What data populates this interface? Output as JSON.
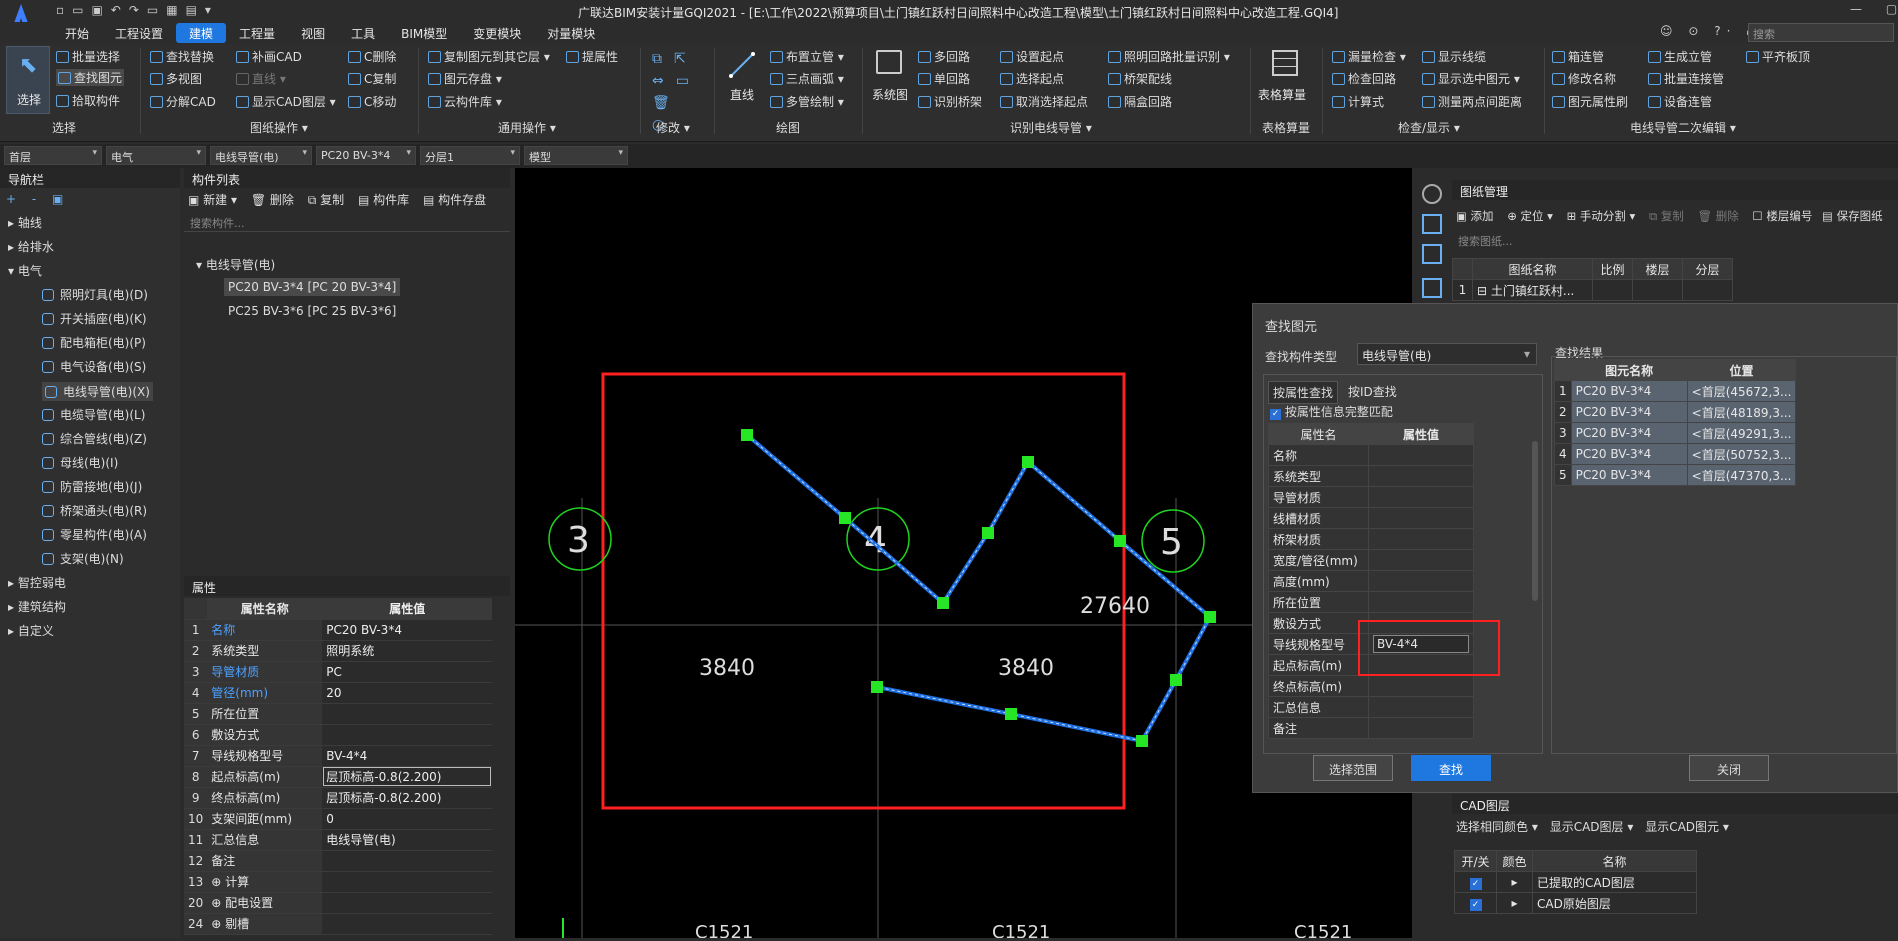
{
  "app": {
    "title": "广联达BIM安装计量GQI2021 - [E:\\工作\\2022\\预算项目\\土门镇红跃村日间照料中心改造工程\\模型\\土门镇红跃村日间照料中心改造工程.GQI4]",
    "search_placeholder": "搜索"
  },
  "menu": [
    "开始",
    "工程设置",
    "建模",
    "工程量",
    "视图",
    "工具",
    "BIM模型",
    "变更模块",
    "对量模块"
  ],
  "menu_active": "建模",
  "ribbon": {
    "select": {
      "big": "选择",
      "items": [
        "批量选择",
        "查找图元",
        "拾取构件"
      ],
      "group": "选择"
    },
    "drawing": {
      "items": [
        "查找替换",
        "补画CAD",
        "C删除",
        "多视图",
        "直线",
        "C复制",
        "分解CAD",
        "显示CAD图层",
        "C移动"
      ],
      "group": "图纸操作"
    },
    "general": {
      "items": [
        "复制图元到其它层",
        "提属性",
        "图元存盘",
        "云构件库"
      ],
      "group": "通用操作"
    },
    "modify": {
      "group": "修改"
    },
    "draw": {
      "big": "直线",
      "items": [
        "布置立管",
        "三点画弧",
        "多管绘制"
      ],
      "group": "绘图"
    },
    "identify": {
      "big": "系统图",
      "items": [
        "多回路",
        "设置起点",
        "照明回路批量识别",
        "单回路",
        "选择起点",
        "桥架配线",
        "识别桥架",
        "取消选择起点",
        "隔盒回路"
      ],
      "group": "识别电线导管"
    },
    "table": {
      "big": "表格算量",
      "group": "表格算量"
    },
    "check": {
      "items": [
        "漏量检查",
        "显示线缆",
        "检查回路",
        "显示选中图元",
        "计算式",
        "测量两点间距离"
      ],
      "group": "检查/显示"
    },
    "edit2": {
      "items": [
        "箱连管",
        "生成立管",
        "平齐板顶",
        "修改名称",
        "批量连接管",
        "图元属性刷",
        "设备连管"
      ],
      "group": "电线导管二次编辑"
    }
  },
  "selectors": [
    "首层",
    "电气",
    "电线导管(电)",
    "PC20 BV-3*4",
    "分层1",
    "模型"
  ],
  "nav": {
    "title": "导航栏",
    "items": [
      "轴线",
      "给排水",
      "电气",
      "智控弱电",
      "建筑结构",
      "自定义"
    ],
    "sub": [
      "照明灯具(电)(D)",
      "开关插座(电)(K)",
      "配电箱柜(电)(P)",
      "电气设备(电)(S)",
      "电线导管(电)(X)",
      "电缆导管(电)(L)",
      "综合管线(电)(Z)",
      "母线(电)(I)",
      "防雷接地(电)(J)",
      "桥架通头(电)(R)",
      "零星构件(电)(A)",
      "支架(电)(N)"
    ]
  },
  "complist": {
    "title": "构件列表",
    "toolbar": [
      "新建",
      "删除",
      "复制",
      "构件库",
      "构件存盘"
    ],
    "search_placeholder": "搜索构件...",
    "root": "电线导管(电)",
    "items": [
      "PC20 BV-3*4 [PC 20 BV-3*4]",
      "PC25 BV-3*6 [PC 25 BV-3*6]"
    ]
  },
  "props": {
    "title": "属性",
    "col_name": "属性名称",
    "col_value": "属性值",
    "rows": [
      {
        "n": "1",
        "k": "名称",
        "v": "PC20 BV-3*4",
        "blue": true
      },
      {
        "n": "2",
        "k": "系统类型",
        "v": "照明系统"
      },
      {
        "n": "3",
        "k": "导管材质",
        "v": "PC",
        "blue": true
      },
      {
        "n": "4",
        "k": "管径(mm)",
        "v": "20",
        "blue": true
      },
      {
        "n": "5",
        "k": "所在位置",
        "v": ""
      },
      {
        "n": "6",
        "k": "敷设方式",
        "v": ""
      },
      {
        "n": "7",
        "k": "导线规格型号",
        "v": "BV-4*4"
      },
      {
        "n": "8",
        "k": "起点标高(m)",
        "v": "层顶标高-0.8(2.200)"
      },
      {
        "n": "9",
        "k": "终点标高(m)",
        "v": "层顶标高-0.8(2.200)"
      },
      {
        "n": "10",
        "k": "支架间距(mm)",
        "v": "0"
      },
      {
        "n": "11",
        "k": "汇总信息",
        "v": "电线导管(电)"
      },
      {
        "n": "12",
        "k": "备注",
        "v": ""
      },
      {
        "n": "13",
        "k": "⊕ 计算",
        "v": ""
      },
      {
        "n": "20",
        "k": "⊕ 配电设置",
        "v": ""
      },
      {
        "n": "24",
        "k": "⊕ 剔槽",
        "v": ""
      }
    ]
  },
  "canvas": {
    "axes": [
      "3",
      "4",
      "5"
    ],
    "dims": [
      "3840",
      "3840",
      "27640"
    ],
    "bottom": [
      "C1521",
      "C1521",
      "C1521"
    ]
  },
  "drawings": {
    "title": "图纸管理",
    "toolbar": [
      "添加",
      "定位",
      "手动分割",
      "复制",
      "删除",
      "楼层编号",
      "保存图纸"
    ],
    "search_placeholder": "搜索图纸...",
    "cols": [
      "图纸名称",
      "比例",
      "楼层",
      "分层"
    ],
    "row": [
      "1",
      "土门镇红跃村...",
      "",
      ""
    ]
  },
  "find": {
    "title": "查找图元",
    "type_label": "查找构件类型",
    "type_value": "电线导管(电)",
    "tabs": [
      "按属性查找",
      "按ID查找"
    ],
    "checkbox": "按属性信息完整匹配",
    "cols": [
      "属性名",
      "属性值"
    ],
    "rows": [
      "名称",
      "系统类型",
      "导管材质",
      "线槽材质",
      "桥架材质",
      "宽度/管径(mm)",
      "高度(mm)",
      "所在位置",
      "敷设方式",
      "导线规格型号",
      "起点标高(m)",
      "终点标高(m)",
      "汇总信息",
      "备注"
    ],
    "input_value": "BV-4*4",
    "results_title": "查找结果",
    "res_cols": [
      "图元名称",
      "位置"
    ],
    "results": [
      [
        "1",
        "PC20 BV-3*4",
        "<首层(45672,3..."
      ],
      [
        "2",
        "PC20 BV-3*4",
        "<首层(48189,3..."
      ],
      [
        "3",
        "PC20 BV-3*4",
        "<首层(49291,3..."
      ],
      [
        "4",
        "PC20 BV-3*4",
        "<首层(50752,3..."
      ],
      [
        "5",
        "PC20 BV-3*4",
        "<首层(47370,3..."
      ]
    ],
    "btn_range": "选择范围",
    "btn_find": "查找",
    "btn_close": "关闭"
  },
  "cad": {
    "title": "CAD图层",
    "toolbar": [
      "选择相同颜色",
      "显示CAD图层",
      "显示CAD图元"
    ],
    "cols": [
      "开/关",
      "颜色",
      "名称"
    ],
    "rows": [
      "已提取的CAD图层",
      "CAD原始图层"
    ]
  }
}
